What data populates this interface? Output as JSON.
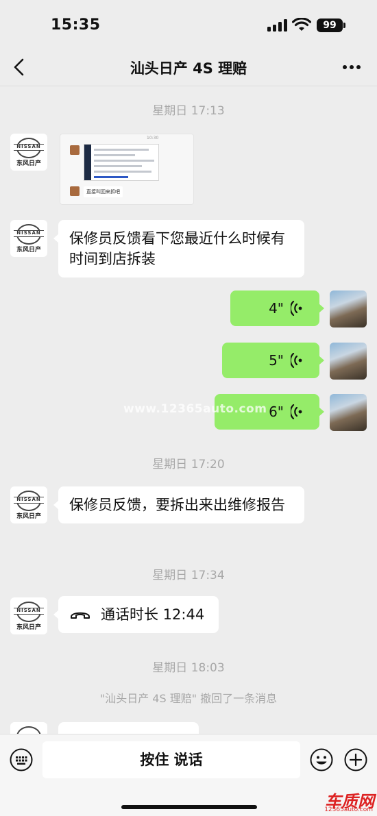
{
  "status_bar": {
    "time": "15:35",
    "battery": "99"
  },
  "nav": {
    "title": "汕头日产 4S 理赔"
  },
  "avatar": {
    "brand_word": "NISSAN",
    "brand_cn": "东风日产"
  },
  "messages": {
    "ts1": "星期日 17:13",
    "screenshot": {
      "time": "10:30",
      "caption": "直接叫回来拆吧"
    },
    "msg1": "保修员反馈看下您最近什么时候有时间到店拆装",
    "voice1": "4\"",
    "voice2": "5\"",
    "voice3": "6\"",
    "ts2": "星期日 17:20",
    "msg2": "保修员反馈，要拆出来出维修报告",
    "ts3": "星期日 17:34",
    "call": "通话时长 12:44",
    "ts4": "星期日 18:03",
    "recall": "\"汕头日产 4S 理赔\" 撤回了一条消息"
  },
  "watermark": "www.12365auto.com",
  "input_bar": {
    "hold_to_talk": "按住 说话"
  },
  "corner_logo": {
    "main": "车质网",
    "sub": "12365auto.com"
  },
  "colors": {
    "bubble_mine": "#95ec69",
    "bubble_theirs": "#ffffff",
    "background": "#ededed"
  },
  "icons": [
    "back-icon",
    "more-icon",
    "voice-icon",
    "phone-icon",
    "keyboard-icon",
    "emoji-icon",
    "plus-icon"
  ]
}
